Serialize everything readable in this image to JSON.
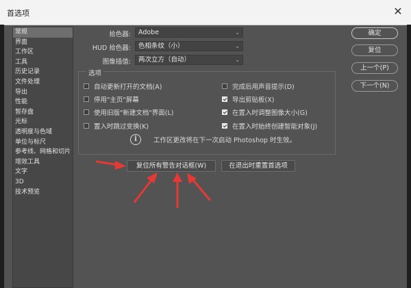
{
  "window": {
    "title": "首选项",
    "close_glyph": "✕"
  },
  "sidebar": {
    "items": [
      {
        "label": "常规",
        "active": true
      },
      {
        "label": "界面"
      },
      {
        "label": "工作区"
      },
      {
        "label": "工具"
      },
      {
        "label": "历史记录"
      },
      {
        "label": "文件处理"
      },
      {
        "label": "导出"
      },
      {
        "label": "性能"
      },
      {
        "label": "暂存盘"
      },
      {
        "label": "光标"
      },
      {
        "label": "透明度与色域"
      },
      {
        "label": "单位与标尺"
      },
      {
        "label": "参考线、网格和切片"
      },
      {
        "label": "增效工具"
      },
      {
        "label": "文字"
      },
      {
        "label": "3D"
      },
      {
        "label": "技术预览"
      }
    ]
  },
  "fields": {
    "color_picker": {
      "label": "拾色器:",
      "value": "Adobe"
    },
    "hud_picker": {
      "label": "HUD 拾色器:",
      "value": "色相条纹（小）"
    },
    "interpolation": {
      "label": "图像插值:",
      "value": "两次立方（自动）"
    }
  },
  "options": {
    "title": "选项",
    "checkboxes": [
      {
        "label": "自动更新打开的文档(A)",
        "checked": false
      },
      {
        "label": "完成后用声音提示(D)",
        "checked": false
      },
      {
        "label": "停用\"主页\"屏幕",
        "checked": false
      },
      {
        "label": "导出剪贴板(X)",
        "checked": true
      },
      {
        "label": "使用旧版\"新建文档\"界面(L)",
        "checked": false
      },
      {
        "label": "在置入时调整图像大小(G)",
        "checked": true
      },
      {
        "label": "置入时跳过变换(K)",
        "checked": false
      },
      {
        "label": "在置入时始终创建智能对象(J)",
        "checked": true
      }
    ],
    "info_text": "工作区更改将在下一次启动 Photoshop 时生效。"
  },
  "buttons": {
    "reset_warnings": "复位所有警告对话框(W)",
    "reset_on_quit": "在退出时重置首选项"
  },
  "right_buttons": {
    "ok": "确定",
    "reset": "复位",
    "prev": "上一个(P)",
    "next": "下一个(N)"
  },
  "colors": {
    "annotation_arrow": "#e53935"
  },
  "icons": {
    "info": "info-icon",
    "close": "close-icon",
    "dropdown": "chevron-down-icon"
  }
}
